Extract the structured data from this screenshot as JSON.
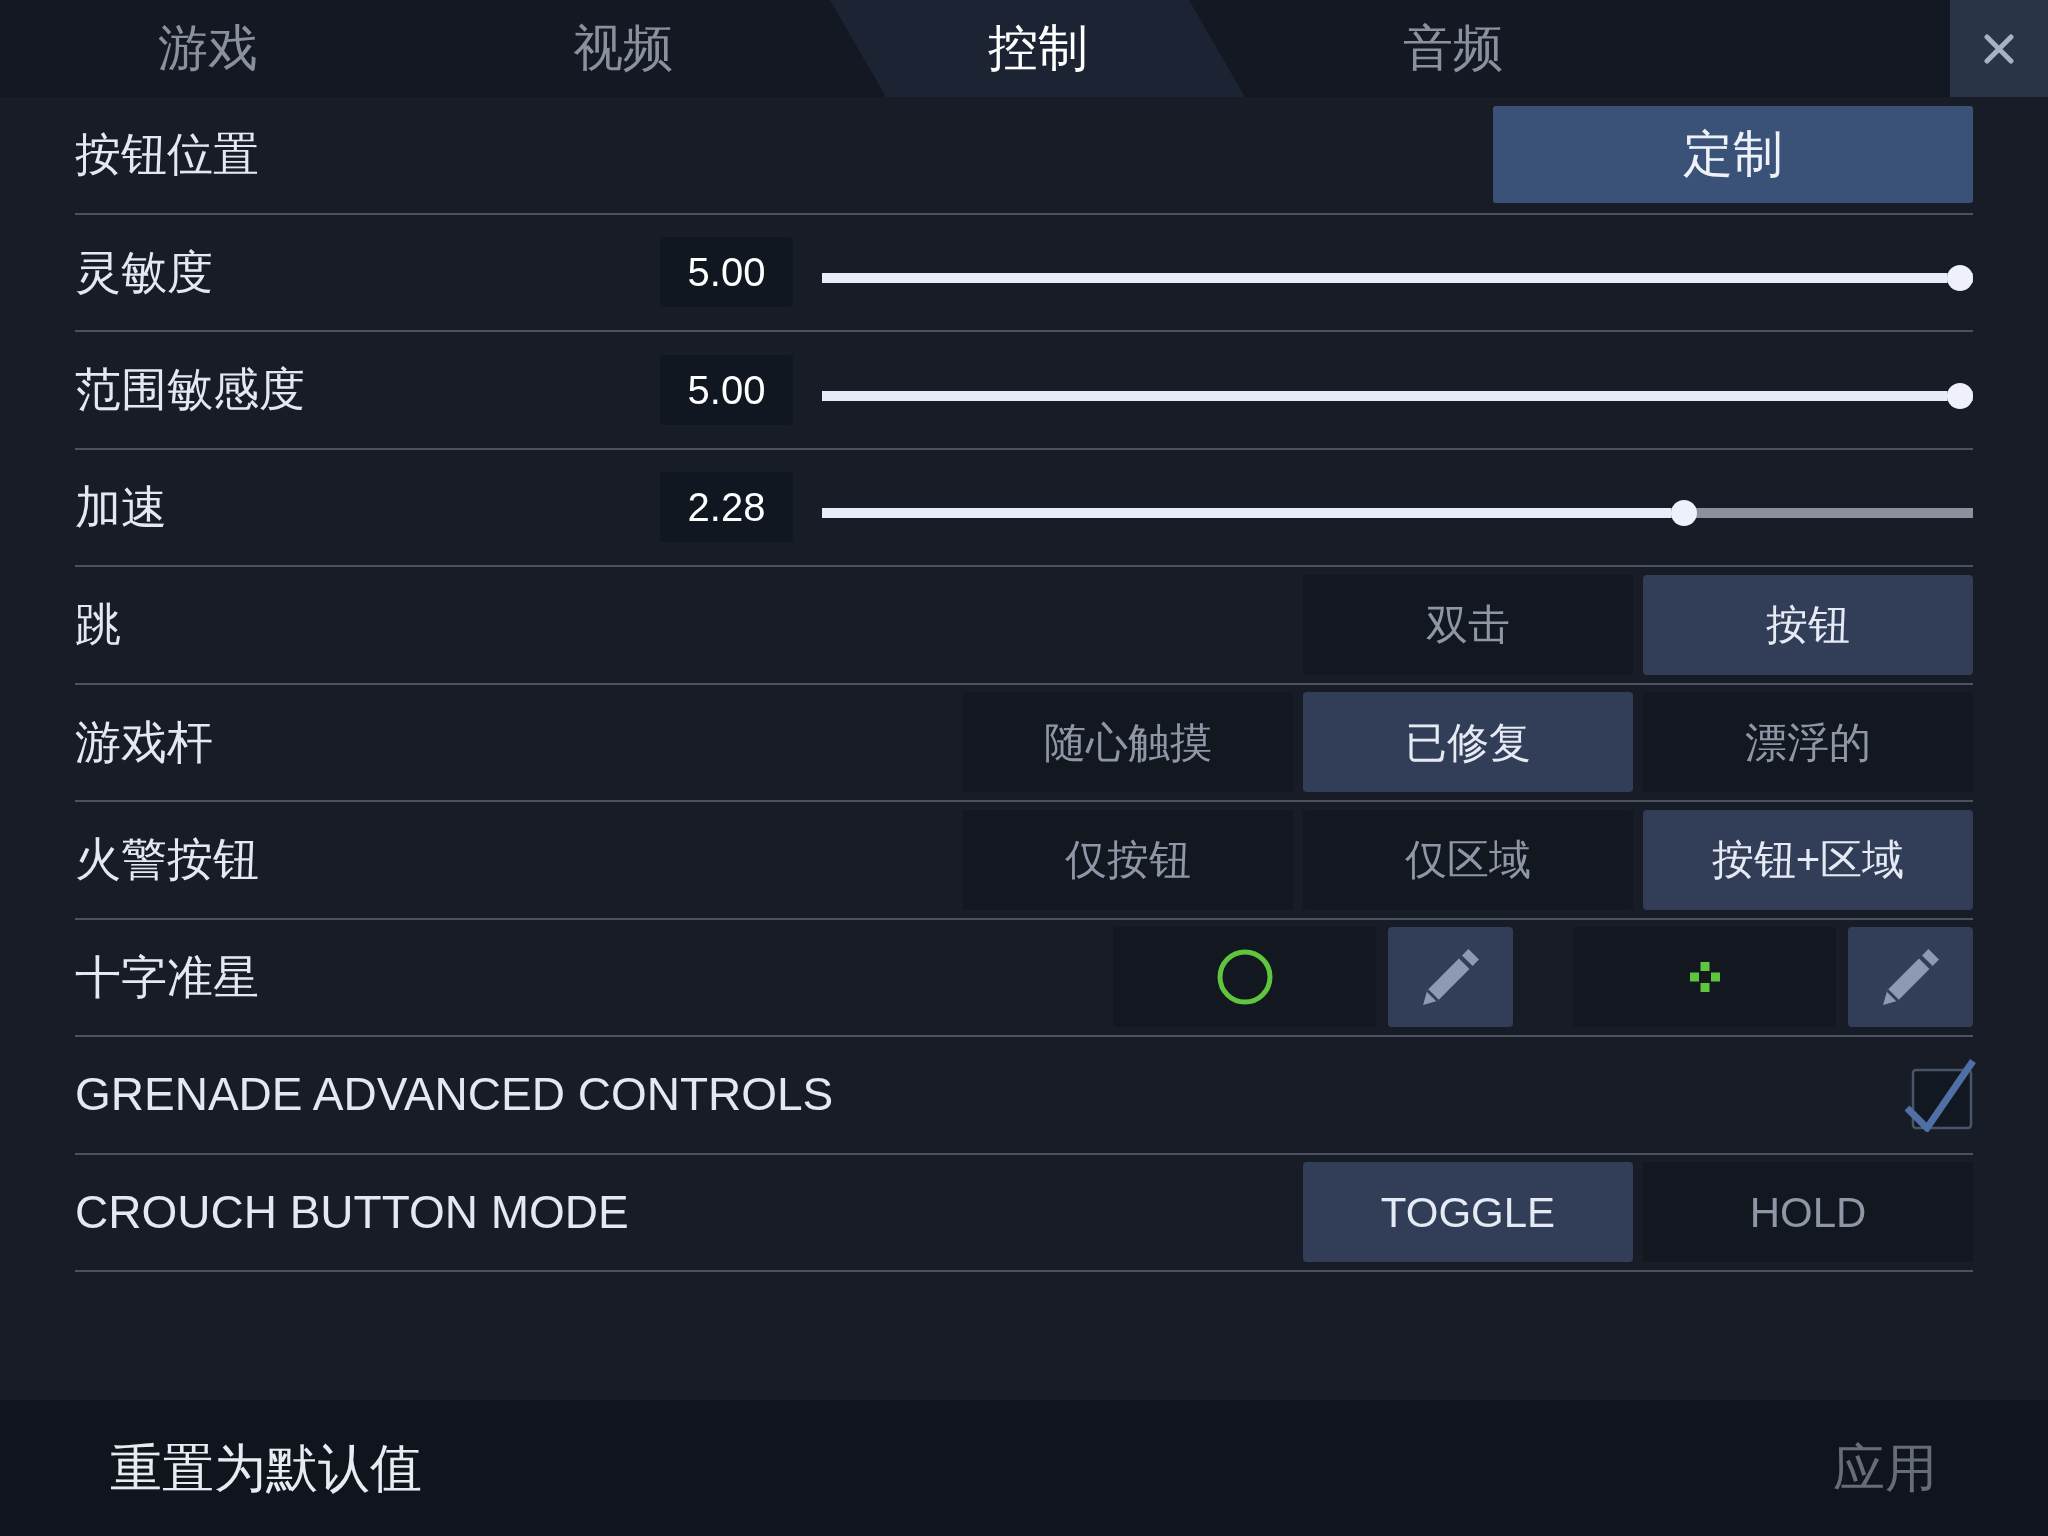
{
  "tabs": [
    {
      "label": "游戏",
      "selected": false
    },
    {
      "label": "视频",
      "selected": false
    },
    {
      "label": "控制",
      "selected": true
    },
    {
      "label": "音频",
      "selected": false
    }
  ],
  "settings": [
    {
      "kind": "button",
      "label": "按钮位置",
      "button": "定制"
    },
    {
      "kind": "slider",
      "label": "灵敏度",
      "value": "5.00",
      "level": 1
    },
    {
      "kind": "slider",
      "label": "范围敏感度",
      "value": "5.00",
      "level": 1
    },
    {
      "kind": "slider",
      "label": "加速",
      "value": "2.28",
      "level": 0.755
    },
    {
      "kind": "segmented",
      "label": "跳",
      "options": [
        {
          "label": "双击",
          "selected": false
        },
        {
          "label": "按钮",
          "selected": true
        }
      ]
    },
    {
      "kind": "segmented",
      "label": "游戏杆",
      "options": [
        {
          "label": "随心触摸",
          "selected": false
        },
        {
          "label": "已修复",
          "selected": true
        },
        {
          "label": "漂浮的",
          "selected": false
        }
      ]
    },
    {
      "kind": "segmented",
      "label": "火警按钮",
      "options": [
        {
          "label": "仅按钮",
          "selected": false
        },
        {
          "label": "仅区域",
          "selected": false
        },
        {
          "label": "按钮+区域",
          "selected": true
        }
      ]
    },
    {
      "kind": "crosshair",
      "label": "十字准星",
      "crosshairs": [
        {
          "kind": "circle"
        },
        {
          "kind": "dots"
        }
      ]
    },
    {
      "kind": "checkbox",
      "label": "GRENADE ADVANCED CONTROLS",
      "checked": true
    },
    {
      "kind": "segmented",
      "label": "CROUCH BUTTON MODE",
      "options": [
        {
          "label": "TOGGLE",
          "selected": true
        },
        {
          "label": "HOLD",
          "selected": false
        }
      ]
    }
  ],
  "footer": {
    "reset": "重置为默认值",
    "apply": {
      "label": "应用",
      "disabled": true
    }
  }
}
